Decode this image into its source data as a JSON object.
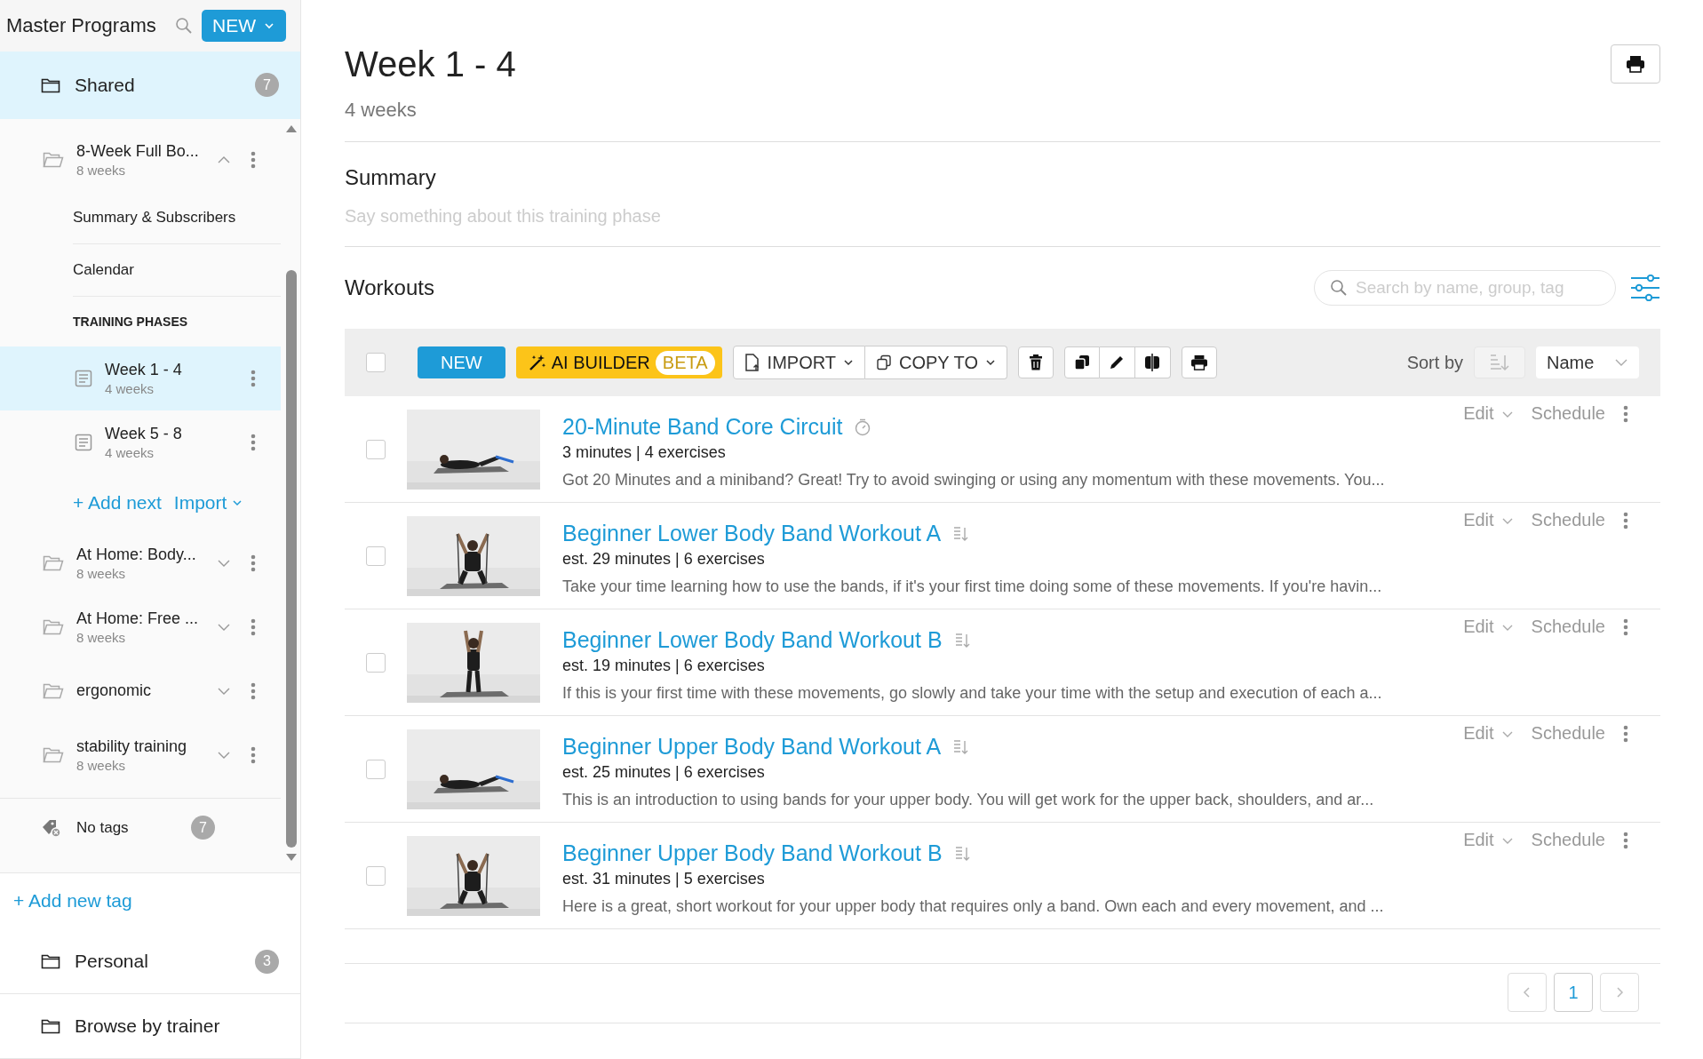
{
  "sidebar": {
    "title": "Master Programs",
    "new_button": "NEW",
    "shared": {
      "name": "Shared",
      "count": "7",
      "selected": true
    },
    "programs": [
      {
        "name": "8-Week Full Bo...",
        "sub": "8 weeks",
        "expanded": true,
        "links": [
          "Summary & Subscribers",
          "Calendar"
        ],
        "section": "TRAINING PHASES",
        "phases": [
          {
            "name": "Week 1 - 4",
            "sub": "4 weeks",
            "selected": true
          },
          {
            "name": "Week 5 - 8",
            "sub": "4 weeks",
            "selected": false
          }
        ],
        "add_next": "+ Add next",
        "import": "Import"
      },
      {
        "name": "At Home: Body...",
        "sub": "8 weeks",
        "expanded": false
      },
      {
        "name": "At Home: Free ...",
        "sub": "8 weeks",
        "expanded": false
      },
      {
        "name": "ergonomic",
        "expanded": false
      },
      {
        "name": "stability training",
        "sub": "8 weeks",
        "expanded": false
      }
    ],
    "no_tags": {
      "label": "No tags",
      "count": "7"
    },
    "add_tag": "+ Add new tag",
    "folders": [
      {
        "name": "Personal",
        "count": "3",
        "selected": false
      },
      {
        "name": "Browse by trainer",
        "selected": false
      }
    ]
  },
  "main": {
    "title": "Week 1 - 4",
    "subtitle": "4 weeks",
    "summary": {
      "heading": "Summary",
      "placeholder": "Say something about this training phase"
    },
    "workouts": {
      "heading": "Workouts",
      "search_placeholder": "Search by name, group, tag",
      "toolbar": {
        "select_all": false,
        "new": "NEW",
        "ai_builder": "AI BUILDER",
        "ai_badge": "BETA",
        "import": "IMPORT",
        "copy_to": "COPY TO",
        "sort_label": "Sort by",
        "sort_value": "Name"
      },
      "rows": [
        {
          "checked": false,
          "title": "20-Minute Band Core Circuit",
          "kind": "timed",
          "meta": "3 minutes | 4 exercises",
          "description": "Got 20 Minutes and a miniband? Great! Try to avoid swinging or using any momentum with these movements. You...",
          "edit": "Edit",
          "schedule": "Schedule"
        },
        {
          "checked": false,
          "title": "Beginner Lower Body Band Workout A",
          "kind": "sequence",
          "meta": "est. 29 minutes | 6 exercises",
          "description": "Take your time learning how to use the bands, if it's your first time doing some of these movements. If you're havin...",
          "edit": "Edit",
          "schedule": "Schedule"
        },
        {
          "checked": false,
          "title": "Beginner Lower Body Band Workout B",
          "kind": "sequence",
          "meta": "est. 19 minutes | 6 exercises",
          "description": "If this is your first time with these movements, go slowly and take your time with the setup and execution of each a...",
          "edit": "Edit",
          "schedule": "Schedule"
        },
        {
          "checked": false,
          "title": "Beginner Upper Body Band Workout A",
          "kind": "sequence",
          "meta": "est. 25 minutes | 6 exercises",
          "description": "This is an introduction to using bands for your upper body. You will get work for the upper back, shoulders, and ar...",
          "edit": "Edit",
          "schedule": "Schedule"
        },
        {
          "checked": false,
          "title": "Beginner Upper Body Band Workout B",
          "kind": "sequence",
          "meta": "est. 31 minutes | 5 exercises",
          "description": "Here is a great, short workout for your upper body that requires only a band. Own each and every movement, and ...",
          "edit": "Edit",
          "schedule": "Schedule"
        }
      ],
      "pages": [
        {
          "label": "1",
          "selected": true
        }
      ]
    }
  }
}
